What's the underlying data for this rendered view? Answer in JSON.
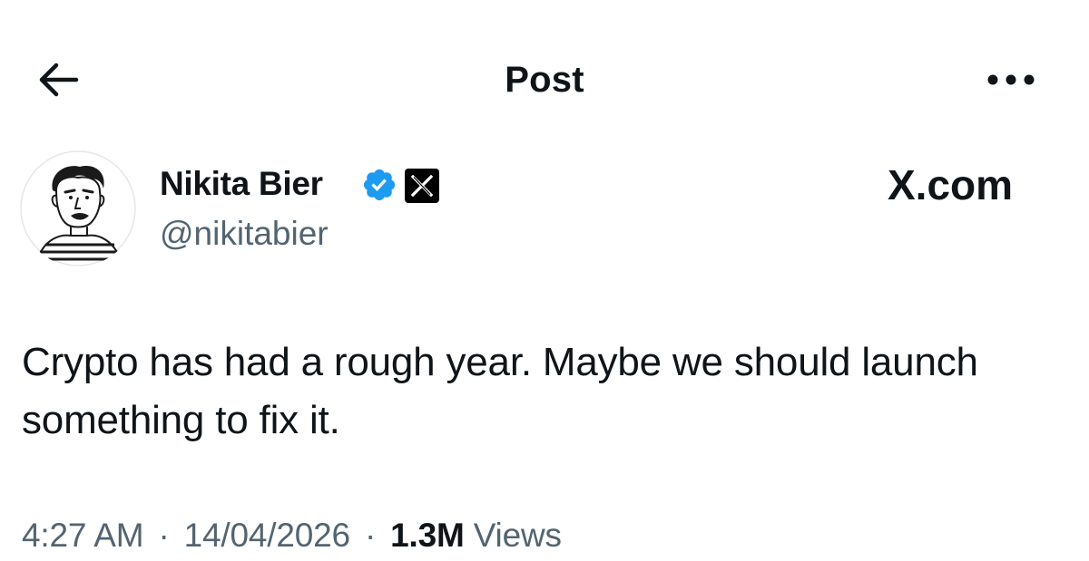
{
  "header": {
    "title": "Post",
    "back_icon": "arrow-left-icon",
    "more_icon": "more-horizontal-icon"
  },
  "author": {
    "name": "Nikita Bier",
    "handle": "@nikitabier",
    "verified": true,
    "verified_color": "#1d9bf0",
    "affiliate_badge_icon": "x-logo-icon"
  },
  "watermark": {
    "text": "X.com"
  },
  "post": {
    "text": "Crypto has had a rough year. Maybe we should launch something to fix it.",
    "time": "4:27 AM",
    "date": "14/04/2026",
    "separator": "·",
    "views_count": "1.3M",
    "views_label": "Views"
  },
  "colors": {
    "text_primary": "#0f1419",
    "text_secondary": "#536471",
    "verified_blue": "#1d9bf0"
  }
}
